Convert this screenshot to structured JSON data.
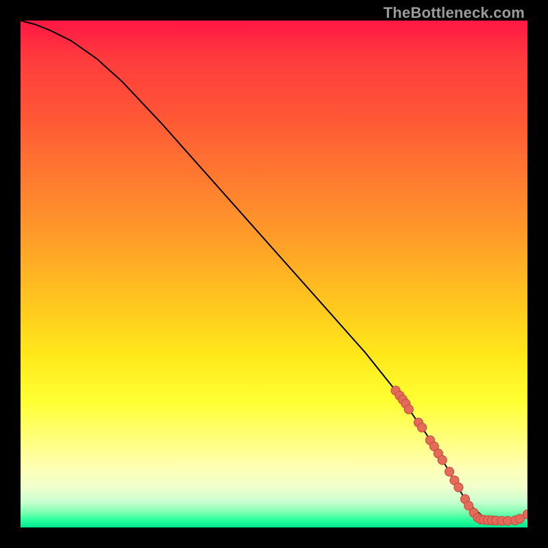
{
  "attribution": "TheBottleneck.com",
  "colors": {
    "point_fill": "#e46a5a",
    "point_stroke": "#c94f41",
    "line": "#000000"
  },
  "chart_data": {
    "type": "line",
    "title": "",
    "xlabel": "",
    "ylabel": "",
    "xlim": [
      0,
      100
    ],
    "ylim": [
      0,
      100
    ],
    "series": [
      {
        "name": "curve",
        "x": [
          0,
          3,
          6,
          10,
          15,
          20,
          28,
          36,
          44,
          52,
          60,
          68,
          74,
          80,
          84,
          88,
          92,
          96,
          100
        ],
        "y": [
          100,
          99.2,
          98.0,
          96.0,
          92.5,
          88.0,
          79.5,
          70.5,
          61.5,
          52.5,
          43.5,
          34.5,
          27.0,
          18.5,
          12.0,
          5.0,
          1.5,
          1.3,
          2.5
        ]
      }
    ],
    "points": [
      {
        "x": 74.0,
        "y": 27.0
      },
      {
        "x": 74.8,
        "y": 26.0
      },
      {
        "x": 75.4,
        "y": 25.2
      },
      {
        "x": 76.0,
        "y": 24.4
      },
      {
        "x": 76.6,
        "y": 23.3
      },
      {
        "x": 78.5,
        "y": 20.7
      },
      {
        "x": 79.2,
        "y": 19.7
      },
      {
        "x": 80.8,
        "y": 17.2
      },
      {
        "x": 81.6,
        "y": 16.0
      },
      {
        "x": 82.4,
        "y": 14.6
      },
      {
        "x": 83.2,
        "y": 13.3
      },
      {
        "x": 84.6,
        "y": 11.0
      },
      {
        "x": 85.6,
        "y": 9.3
      },
      {
        "x": 86.4,
        "y": 7.9
      },
      {
        "x": 87.7,
        "y": 5.6
      },
      {
        "x": 88.4,
        "y": 4.3
      },
      {
        "x": 89.4,
        "y": 2.9
      },
      {
        "x": 90.2,
        "y": 1.9
      },
      {
        "x": 90.8,
        "y": 1.6
      },
      {
        "x": 91.4,
        "y": 1.5
      },
      {
        "x": 92.2,
        "y": 1.45
      },
      {
        "x": 93.0,
        "y": 1.4
      },
      {
        "x": 93.8,
        "y": 1.35
      },
      {
        "x": 94.9,
        "y": 1.3
      },
      {
        "x": 96.1,
        "y": 1.3
      },
      {
        "x": 97.6,
        "y": 1.4
      },
      {
        "x": 98.5,
        "y": 1.7
      },
      {
        "x": 100.0,
        "y": 2.6
      }
    ]
  }
}
